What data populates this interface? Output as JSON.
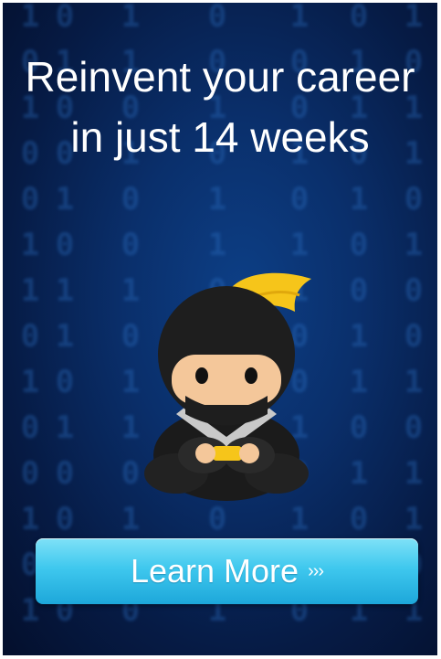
{
  "ad": {
    "headline": "Reinvent your career in just 14 weeks",
    "cta_label": "Learn More",
    "cta_arrows": "›››",
    "mascot_icon": "ninja-mascot",
    "binary_digits": [
      "0",
      "1"
    ]
  },
  "colors": {
    "background": "#0a2f6b",
    "button": "#3fc8ee",
    "headband": "#f6c51a"
  }
}
